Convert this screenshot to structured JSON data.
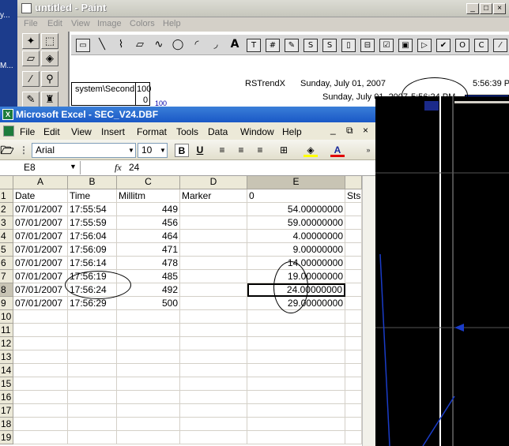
{
  "desktop": {
    "labels": [
      "y...",
      "M...",
      "..."
    ]
  },
  "paint": {
    "title": "untitled - Paint",
    "window_buttons": [
      "_",
      "□",
      "×"
    ],
    "menu": [
      "File",
      "Edit",
      "View",
      "Image",
      "Colors",
      "Help"
    ],
    "canvas": {
      "control_name": "RSTrendX",
      "header_date": "Sunday, July 01, 2007",
      "header_time": "5:56:39 P",
      "cursor_date": "Sunday, July 01, 2007",
      "cursor_time": "5:56:24 PM",
      "axis_label": "system\\Second",
      "axis_max": "100",
      "axis_min": "0",
      "axis_tick": "100"
    }
  },
  "excel": {
    "title": "Microsoft Excel - SEC_V24.DBF",
    "window_buttons": [
      "_",
      "□",
      "×"
    ],
    "doc_buttons": [
      "_",
      "⧉",
      "×"
    ],
    "menu": [
      "File",
      "Edit",
      "View",
      "Insert",
      "Format",
      "Tools",
      "Data",
      "Window",
      "Help"
    ],
    "font_name": "Arial",
    "font_size": "10",
    "name_box": "E8",
    "fx": "fx",
    "formula": "24",
    "columns": [
      "A",
      "B",
      "C",
      "D",
      "E"
    ],
    "rows": [
      [
        "Date",
        "Time",
        "Millitm",
        "Marker",
        "0",
        "Sts"
      ],
      [
        "07/01/2007",
        "17:55:54",
        "449",
        "",
        "54.00000000"
      ],
      [
        "07/01/2007",
        "17:55:59",
        "456",
        "",
        "59.00000000"
      ],
      [
        "07/01/2007",
        "17:56:04",
        "464",
        "",
        "4.00000000"
      ],
      [
        "07/01/2007",
        "17:56:09",
        "471",
        "",
        "9.00000000"
      ],
      [
        "07/01/2007",
        "17:56:14",
        "478",
        "",
        "14.00000000"
      ],
      [
        "07/01/2007",
        "17:56:19",
        "485",
        "",
        "19.00000000"
      ],
      [
        "07/01/2007",
        "17:56:24",
        "492",
        "",
        "24.00000000"
      ],
      [
        "07/01/2007",
        "17:56:29",
        "500",
        "",
        "29.00000000"
      ]
    ],
    "row_numbers": [
      "1",
      "2",
      "3",
      "4",
      "5",
      "6",
      "7",
      "8",
      "9",
      "10",
      "11",
      "12",
      "13",
      "14",
      "15",
      "16",
      "17",
      "18",
      "19"
    ],
    "selected_cell": "E8"
  }
}
